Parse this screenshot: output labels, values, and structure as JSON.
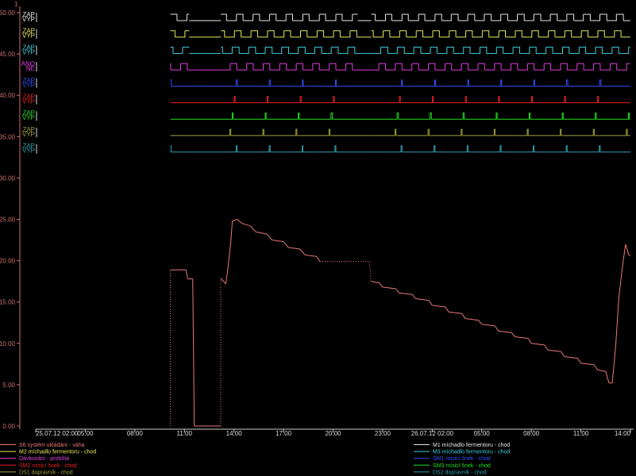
{
  "colors": {
    "background": "#000000",
    "axis": "#c87070",
    "grid": "#555555"
  },
  "chart_data": {
    "type": "line",
    "corner_label": "1",
    "y_ticks": [
      "0.00",
      "5.00",
      "10.00",
      "15.00",
      "20.00",
      "25.00",
      "30.00",
      "35.00",
      "40.00",
      "45.00",
      "50.00"
    ],
    "x_ticks": [
      "25.07.12 02:00",
      "05:00",
      "08:00",
      "11:00",
      "14:00",
      "17:00",
      "20:00",
      "23:00",
      "26.07.12 02:00",
      "05:00",
      "08:00",
      "11:00",
      "14:00"
    ],
    "ylim": [
      0,
      50
    ],
    "x_unit": "hours since 25.07.12 02:00",
    "xlim": [
      0,
      36
    ],
    "series": [
      {
        "name": "S6 systém ukládání - váha",
        "color": "#e87878",
        "points": [
          [
            8.15,
            0
          ],
          [
            8.15,
            18.9
          ],
          [
            9.1,
            18.9
          ],
          [
            9.2,
            17.8
          ],
          [
            9.5,
            17.8
          ],
          [
            9.6,
            0
          ],
          [
            11.2,
            0
          ],
          [
            11.2,
            17.9
          ],
          [
            11.5,
            17.2
          ],
          [
            11.6,
            18.5
          ],
          [
            11.8,
            22.0
          ],
          [
            11.9,
            24.8
          ],
          [
            12.2,
            25.0
          ],
          [
            12.5,
            24.5
          ],
          [
            13.0,
            24.2
          ],
          [
            13.3,
            23.5
          ],
          [
            14.0,
            23.2
          ],
          [
            14.3,
            22.5
          ],
          [
            15.0,
            22.3
          ],
          [
            15.3,
            21.6
          ],
          [
            16.0,
            21.4
          ],
          [
            16.3,
            20.7
          ],
          [
            17.0,
            20.5
          ],
          [
            17.2,
            19.9
          ],
          [
            20.2,
            19.9
          ],
          [
            20.3,
            17.5
          ],
          [
            20.8,
            17.3
          ],
          [
            21.0,
            16.8
          ],
          [
            21.8,
            16.6
          ],
          [
            22.0,
            16.1
          ],
          [
            22.8,
            15.9
          ],
          [
            23.0,
            15.4
          ],
          [
            23.8,
            15.2
          ],
          [
            24.0,
            14.6
          ],
          [
            24.8,
            14.4
          ],
          [
            25.0,
            13.8
          ],
          [
            25.8,
            13.6
          ],
          [
            26.0,
            13.0
          ],
          [
            26.8,
            12.8
          ],
          [
            27.0,
            12.3
          ],
          [
            27.8,
            12.1
          ],
          [
            28.0,
            11.5
          ],
          [
            28.8,
            11.3
          ],
          [
            29.0,
            10.8
          ],
          [
            29.8,
            10.6
          ],
          [
            30.0,
            10.0
          ],
          [
            30.8,
            9.8
          ],
          [
            31.0,
            9.2
          ],
          [
            31.8,
            9.0
          ],
          [
            32.0,
            8.4
          ],
          [
            32.8,
            8.2
          ],
          [
            33.0,
            7.6
          ],
          [
            33.8,
            7.4
          ],
          [
            34.0,
            6.8
          ],
          [
            34.5,
            6.6
          ],
          [
            34.7,
            5.2
          ],
          [
            34.9,
            5.2
          ],
          [
            35.1,
            9.5
          ],
          [
            35.3,
            15.5
          ],
          [
            35.5,
            19.0
          ],
          [
            35.7,
            22.0
          ],
          [
            35.9,
            20.7
          ],
          [
            36.0,
            20.6
          ]
        ]
      }
    ],
    "digital_channels": [
      {
        "on": "ZAP",
        "off": "VYP",
        "color": "#e8e8e8",
        "name": "M1 míchadlo fermentoru - chod",
        "kind": "square"
      },
      {
        "on": "ZAP",
        "off": "VYP",
        "color": "#e8e860",
        "name": "M2 míchadlo fermentoru - chod",
        "kind": "square"
      },
      {
        "on": "ZAP",
        "off": "VYP",
        "color": "#40d0e0",
        "name": "M3 míchadlo fermentoru - chod",
        "kind": "square"
      },
      {
        "on": "ANO",
        "off": "NE",
        "color": "#e040e0",
        "name": "Dávkování - probíhá",
        "kind": "square"
      },
      {
        "on": "ZAP",
        "off": "VYP",
        "color": "#3050ff",
        "name": "SM1 mísicí šnek - chod",
        "kind": "spike"
      },
      {
        "on": "ZAP",
        "off": "VYP",
        "color": "#e82020",
        "name": "SM2 mísicí šnek - chod",
        "kind": "spike"
      },
      {
        "on": "ZAP",
        "off": "VYP",
        "color": "#20e020",
        "name": "SM3 mísicí šnek - chod",
        "kind": "spike"
      },
      {
        "on": "ZAP",
        "off": "VYP",
        "color": "#a0a040",
        "name": "DS1 dopravník - chod",
        "kind": "spike"
      },
      {
        "on": "ZAP",
        "off": "VYP",
        "color": "#30a0b0",
        "name": "DS2 dopravník - chod",
        "kind": "spike"
      }
    ],
    "gaps": [
      [
        9.3,
        11.2
      ],
      [
        19.5,
        20.3
      ],
      [
        35.0,
        35.0
      ]
    ]
  },
  "legend": {
    "left": [
      {
        "label": "S6 systém ukládání - váha",
        "color": "#e87878"
      },
      {
        "label": "M2 míchadlo fermentoru - chod",
        "color": "#e8e860"
      },
      {
        "label": "Dávkování - probíhá",
        "color": "#e040e0"
      },
      {
        "label": "SM2 mísicí šnek - chod",
        "color": "#e82020"
      },
      {
        "label": "DS1 dopravník - chod",
        "color": "#a0a040"
      }
    ],
    "right": [
      {
        "label": "M1 míchadlo fermentoru - chod",
        "color": "#e8e8e8"
      },
      {
        "label": "M3 míchadlo fermentoru - chod",
        "color": "#40d0e0"
      },
      {
        "label": "SM1 mísicí šnek - chod",
        "color": "#3050ff"
      },
      {
        "label": "SM3 mísicí šnek - chod",
        "color": "#20e020"
      },
      {
        "label": "DS2 dopravník - chod",
        "color": "#30a0b0"
      }
    ]
  }
}
